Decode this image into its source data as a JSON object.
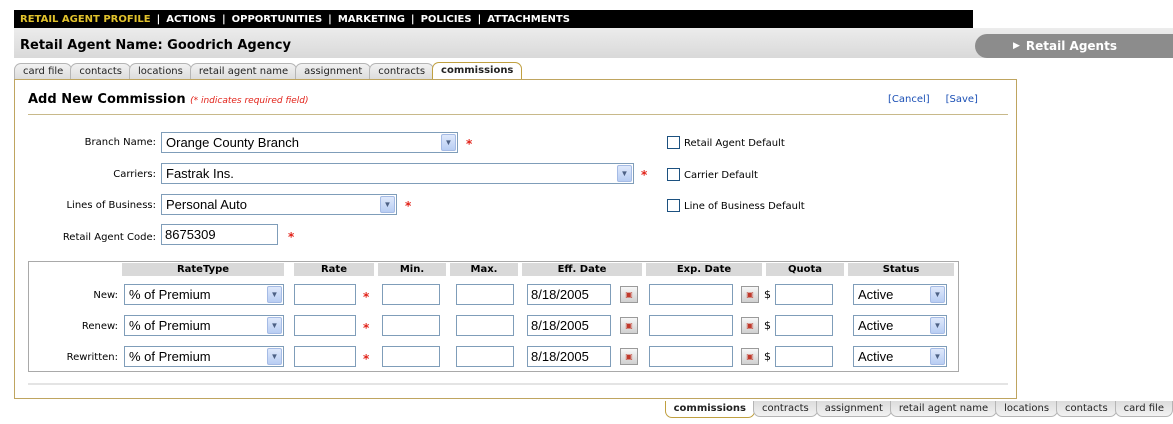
{
  "topnav": {
    "items": [
      "RETAIL AGENT PROFILE",
      "ACTIONS",
      "OPPORTUNITIES",
      "MARKETING",
      "POLICIES",
      "ATTACHMENTS"
    ]
  },
  "header": {
    "title": "Retail Agent Name: Goodrich Agency",
    "right_tab": "Retail Agents"
  },
  "tabs": [
    "card file",
    "contacts",
    "locations",
    "retail agent name",
    "assignment",
    "contracts",
    "commissions"
  ],
  "bottom_tabs": [
    "commissions",
    "contracts",
    "assignment",
    "retail agent name",
    "locations",
    "contacts",
    "card file"
  ],
  "form": {
    "title": "Add New Commission",
    "required_note": "(* indicates required field)",
    "cancel_label": "[Cancel]",
    "save_label": "[Save]",
    "branch_label": "Branch Name:",
    "branch_value": "Orange County Branch",
    "carriers_label": "Carriers:",
    "carriers_value": "Fastrak Ins.",
    "lob_label": "Lines of Business:",
    "lob_value": "Personal Auto",
    "code_label": "Retail Agent Code:",
    "code_value": "8675309",
    "required_star": "*",
    "checkboxes": [
      "Retail Agent Default",
      "Carrier Default",
      "Line of Business Default"
    ]
  },
  "grid": {
    "headers": [
      "RateType",
      "Rate",
      "Min.",
      "Max.",
      "Eff. Date",
      "Exp. Date",
      "Quota",
      "Status"
    ],
    "currency_symbol": "$",
    "rows": [
      {
        "label": "New:",
        "rate_type": "% of Premium",
        "eff_date": "8/18/2005",
        "status": "Active"
      },
      {
        "label": "Renew:",
        "rate_type": "% of Premium",
        "eff_date": "8/18/2005",
        "status": "Active"
      },
      {
        "label": "Rewritten:",
        "rate_type": "% of Premium",
        "eff_date": "8/18/2005",
        "status": "Active"
      }
    ]
  },
  "colors": {
    "nav_active": "#e1c22c",
    "required": "#e2231a",
    "link": "#1a4fb5",
    "panel_border": "#bfa560"
  }
}
